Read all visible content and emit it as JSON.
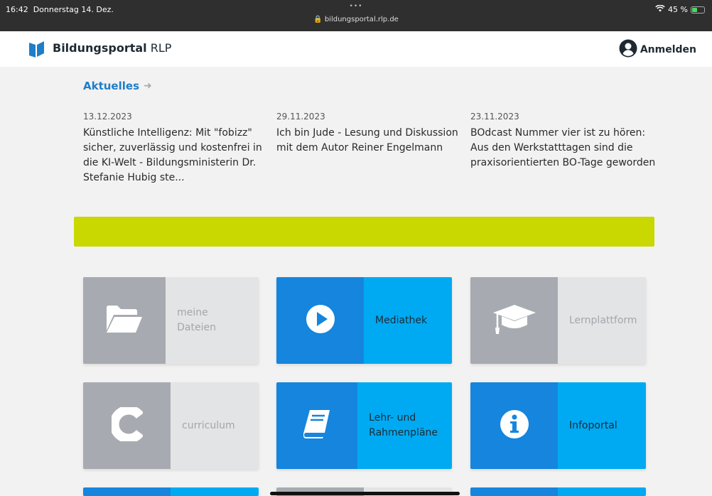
{
  "statusbar": {
    "time": "16:42",
    "date": "Donnerstag 14. Dez.",
    "dots": "•••",
    "url": "bildungsportal.rlp.de",
    "battery": "45 %",
    "battery_level": 0.45
  },
  "header": {
    "brand_bold": "Bildungsportal",
    "brand_rest": " RLP",
    "login_label": "Anmelden"
  },
  "aktuelles": {
    "title": "Aktuelles"
  },
  "news": [
    {
      "date": "13.12.2023",
      "title": "Künstliche Intelligenz: Mit \"fo­bizz\" sicher, zuverlässig und kos­tenfrei in die KI-Welt - Bildungs­ministerin Dr. Stefanie Hubig ste..."
    },
    {
      "date": "29.11.2023",
      "title": "Ich bin Jude - Lesung und Dis­kussion mit dem Autor Reiner Engelmann"
    },
    {
      "date": "23.11.2023",
      "title": "BOdcast Nummer vier ist zu hö­ren: Aus den Werkstatttagen sind die praxisorientierten BO-Tage geworden"
    }
  ],
  "colors": {
    "banner": "#c8d800",
    "accent_blue": "#1e7ec8",
    "tile_blue_dark": "#1585dd",
    "tile_blue_light": "#00aaf2",
    "tile_gray_dark": "#a7abb1",
    "tile_gray_light": "#e3e4e6"
  },
  "tiles": [
    {
      "label": "meine Dateien",
      "icon": "folder-open-icon",
      "style": "gray"
    },
    {
      "label": "Mediathek",
      "icon": "play-circle-icon",
      "style": "blue"
    },
    {
      "label": "Lernplattform",
      "icon": "graduation-cap-icon",
      "style": "gray"
    },
    {
      "label": "curriculum",
      "icon": "curriculum-c-icon",
      "style": "gray"
    },
    {
      "label": "Lehr- und Rahmenpläne",
      "icon": "book-icon",
      "style": "blue"
    },
    {
      "label": "Infoportal",
      "icon": "info-circle-icon",
      "style": "blue"
    }
  ]
}
